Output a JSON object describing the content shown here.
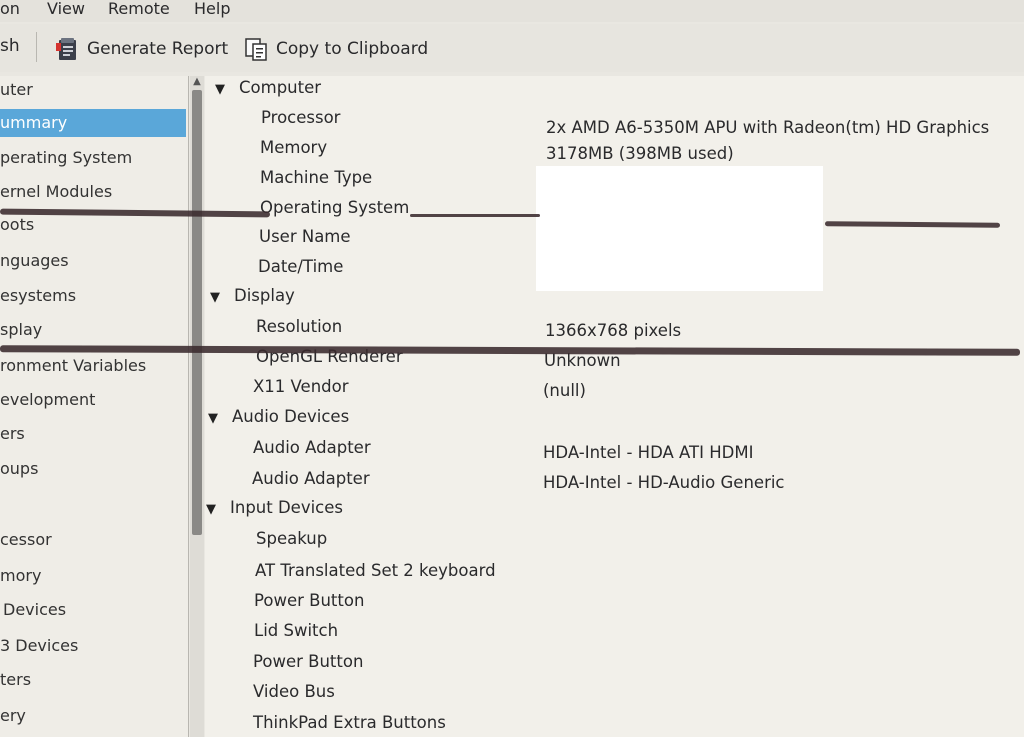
{
  "menubar": {
    "items": [
      "on",
      "View",
      "Remote",
      "Help"
    ]
  },
  "toolbar": {
    "refresh_label": "sh",
    "generate_report_label": "Generate Report",
    "copy_clipboard_label": "Copy to Clipboard"
  },
  "sidebar": {
    "items": [
      {
        "label": "uter"
      },
      {
        "label": "ummary",
        "selected": true
      },
      {
        "label": "perating System"
      },
      {
        "label": "ernel Modules"
      },
      {
        "label": "oots"
      },
      {
        "label": "nguages"
      },
      {
        "label": "esystems"
      },
      {
        "label": "splay"
      },
      {
        "label": "ronment Variables"
      },
      {
        "label": "evelopment"
      },
      {
        "label": "ers"
      },
      {
        "label": "oups"
      },
      {
        "label": ""
      },
      {
        "label": "cessor"
      },
      {
        "label": "mory"
      },
      {
        "label": "Devices"
      },
      {
        "label": "3 Devices"
      },
      {
        "label": "ters"
      },
      {
        "label": "ery"
      }
    ]
  },
  "summary": {
    "sections": [
      {
        "title": "Computer",
        "rows": [
          {
            "label": "Processor",
            "value": "2x AMD A6-5350M APU with Radeon(tm) HD Graphics"
          },
          {
            "label": "Memory",
            "value": "3178MB (398MB used)"
          },
          {
            "label": "Machine Type",
            "value": ""
          },
          {
            "label": "Operating System",
            "value": ""
          },
          {
            "label": "User Name",
            "value": ""
          },
          {
            "label": "Date/Time",
            "value": ""
          }
        ]
      },
      {
        "title": "Display",
        "rows": [
          {
            "label": "Resolution",
            "value": "1366x768 pixels"
          },
          {
            "label": "OpenGL Renderer",
            "value": "Unknown"
          },
          {
            "label": "X11 Vendor",
            "value": "(null)"
          }
        ]
      },
      {
        "title": "Audio Devices",
        "rows": [
          {
            "label": "Audio Adapter",
            "value": "HDA-Intel - HDA ATI HDMI"
          },
          {
            "label": "Audio Adapter",
            "value": "HDA-Intel - HD-Audio Generic"
          }
        ]
      },
      {
        "title": "Input Devices",
        "rows": [
          {
            "label": "Speakup",
            "value": ""
          },
          {
            "label": "AT Translated Set 2 keyboard",
            "value": ""
          },
          {
            "label": "Power Button",
            "value": ""
          },
          {
            "label": "Lid Switch",
            "value": ""
          },
          {
            "label": "Power Button",
            "value": ""
          },
          {
            "label": "Video Bus",
            "value": ""
          },
          {
            "label": "ThinkPad Extra Buttons",
            "value": ""
          }
        ]
      }
    ]
  }
}
